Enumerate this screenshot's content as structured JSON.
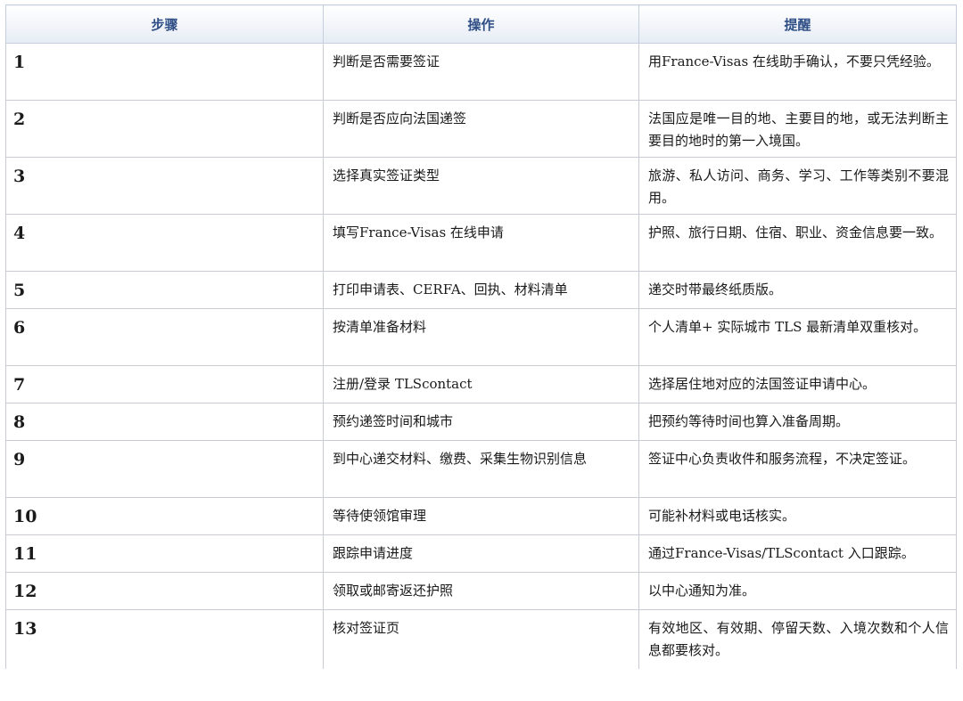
{
  "table": {
    "headers": [
      "步骤",
      "操作",
      "提醒"
    ],
    "rows": [
      {
        "step": "1",
        "action": "判断是否需要签证",
        "tip": "用France-Visas 在线助手确认，不要只凭经验。"
      },
      {
        "step": "2",
        "action": "判断是否应向法国递签",
        "tip": "法国应是唯一目的地、主要目的地，或无法判断主要目的地时的第一入境国。"
      },
      {
        "step": "3",
        "action": "选择真实签证类型",
        "tip": "旅游、私人访问、商务、学习、工作等类别不要混用。"
      },
      {
        "step": "4",
        "action": "填写France-Visas 在线申请",
        "tip": "护照、旅行日期、住宿、职业、资金信息要一致。"
      },
      {
        "step": "5",
        "action": "打印申请表、CERFA、回执、材料清单",
        "tip": "递交时带最终纸质版。"
      },
      {
        "step": "6",
        "action": "按清单准备材料",
        "tip": "个人清单+ 实际城市 TLS 最新清单双重核对。"
      },
      {
        "step": "7",
        "action": "注册/登录 TLScontact",
        "tip": "选择居住地对应的法国签证申请中心。"
      },
      {
        "step": "8",
        "action": "预约递签时间和城市",
        "tip": "把预约等待时间也算入准备周期。"
      },
      {
        "step": "9",
        "action": "到中心递交材料、缴费、采集生物识别信息",
        "tip": "签证中心负责收件和服务流程，不决定签证。"
      },
      {
        "step": "10",
        "action": "等待使领馆审理",
        "tip": "可能补材料或电话核实。"
      },
      {
        "step": "11",
        "action": "跟踪申请进度",
        "tip": "通过France-Visas/TLScontact 入口跟踪。"
      },
      {
        "step": "12",
        "action": "领取或邮寄返还护照",
        "tip": "以中心通知为准。"
      },
      {
        "step": "13",
        "action": "核对签证页",
        "tip": "有效地区、有效期、停留天数、入境次数和个人信息都要核对。"
      }
    ]
  }
}
